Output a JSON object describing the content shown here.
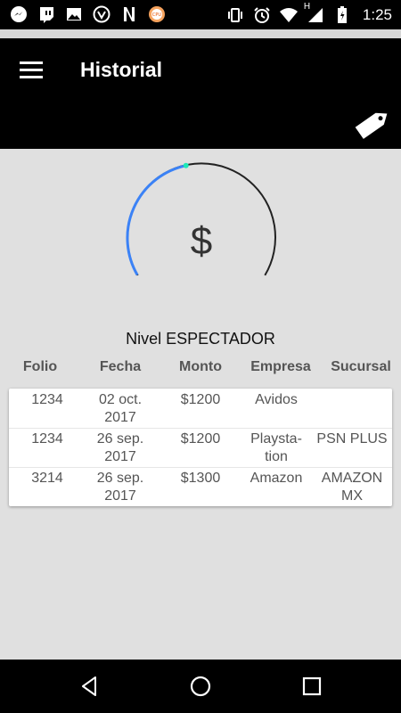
{
  "status_bar": {
    "time": "1:25",
    "left_icons": [
      "messenger-icon",
      "twitch-icon",
      "image-icon",
      "vpn-icon",
      "netflix-icon",
      "cpu-icon"
    ],
    "right_icons": [
      "vibrate-icon",
      "alarm-icon",
      "wifi-icon",
      "signal-icon",
      "battery-icon"
    ],
    "network_letter": "H"
  },
  "app_bar": {
    "title": "Historial"
  },
  "gauge": {
    "symbol": "$",
    "progress_fraction": 0.45,
    "progress_color": "#3b82f6",
    "track_color": "#222222",
    "marker_color": "#1de9b6"
  },
  "level": {
    "text": "Nivel ESPECTADOR"
  },
  "table": {
    "headers": [
      "Folio",
      "Fecha",
      "Monto",
      "Empresa",
      "Sucursal"
    ],
    "rows": [
      {
        "folio": "1234",
        "fecha_1": "02 oct.",
        "fecha_2": "2017",
        "monto": "$1200",
        "empresa_1": "Avidos",
        "empresa_2": "",
        "sucursal_1": "",
        "sucursal_2": ""
      },
      {
        "folio": "1234",
        "fecha_1": "26 sep.",
        "fecha_2": "2017",
        "monto": "$1200",
        "empresa_1": "Playsta-",
        "empresa_2": "tion",
        "sucursal_1": "PSN PLUS",
        "sucursal_2": ""
      },
      {
        "folio": "3214",
        "fecha_1": "26 sep.",
        "fecha_2": "2017",
        "monto": "$1300",
        "empresa_1": "Amazon",
        "empresa_2": "",
        "sucursal_1": "AMAZON",
        "sucursal_2": "MX"
      }
    ]
  },
  "nav_bar": {
    "buttons": [
      "back-icon",
      "home-icon",
      "recents-icon"
    ]
  }
}
